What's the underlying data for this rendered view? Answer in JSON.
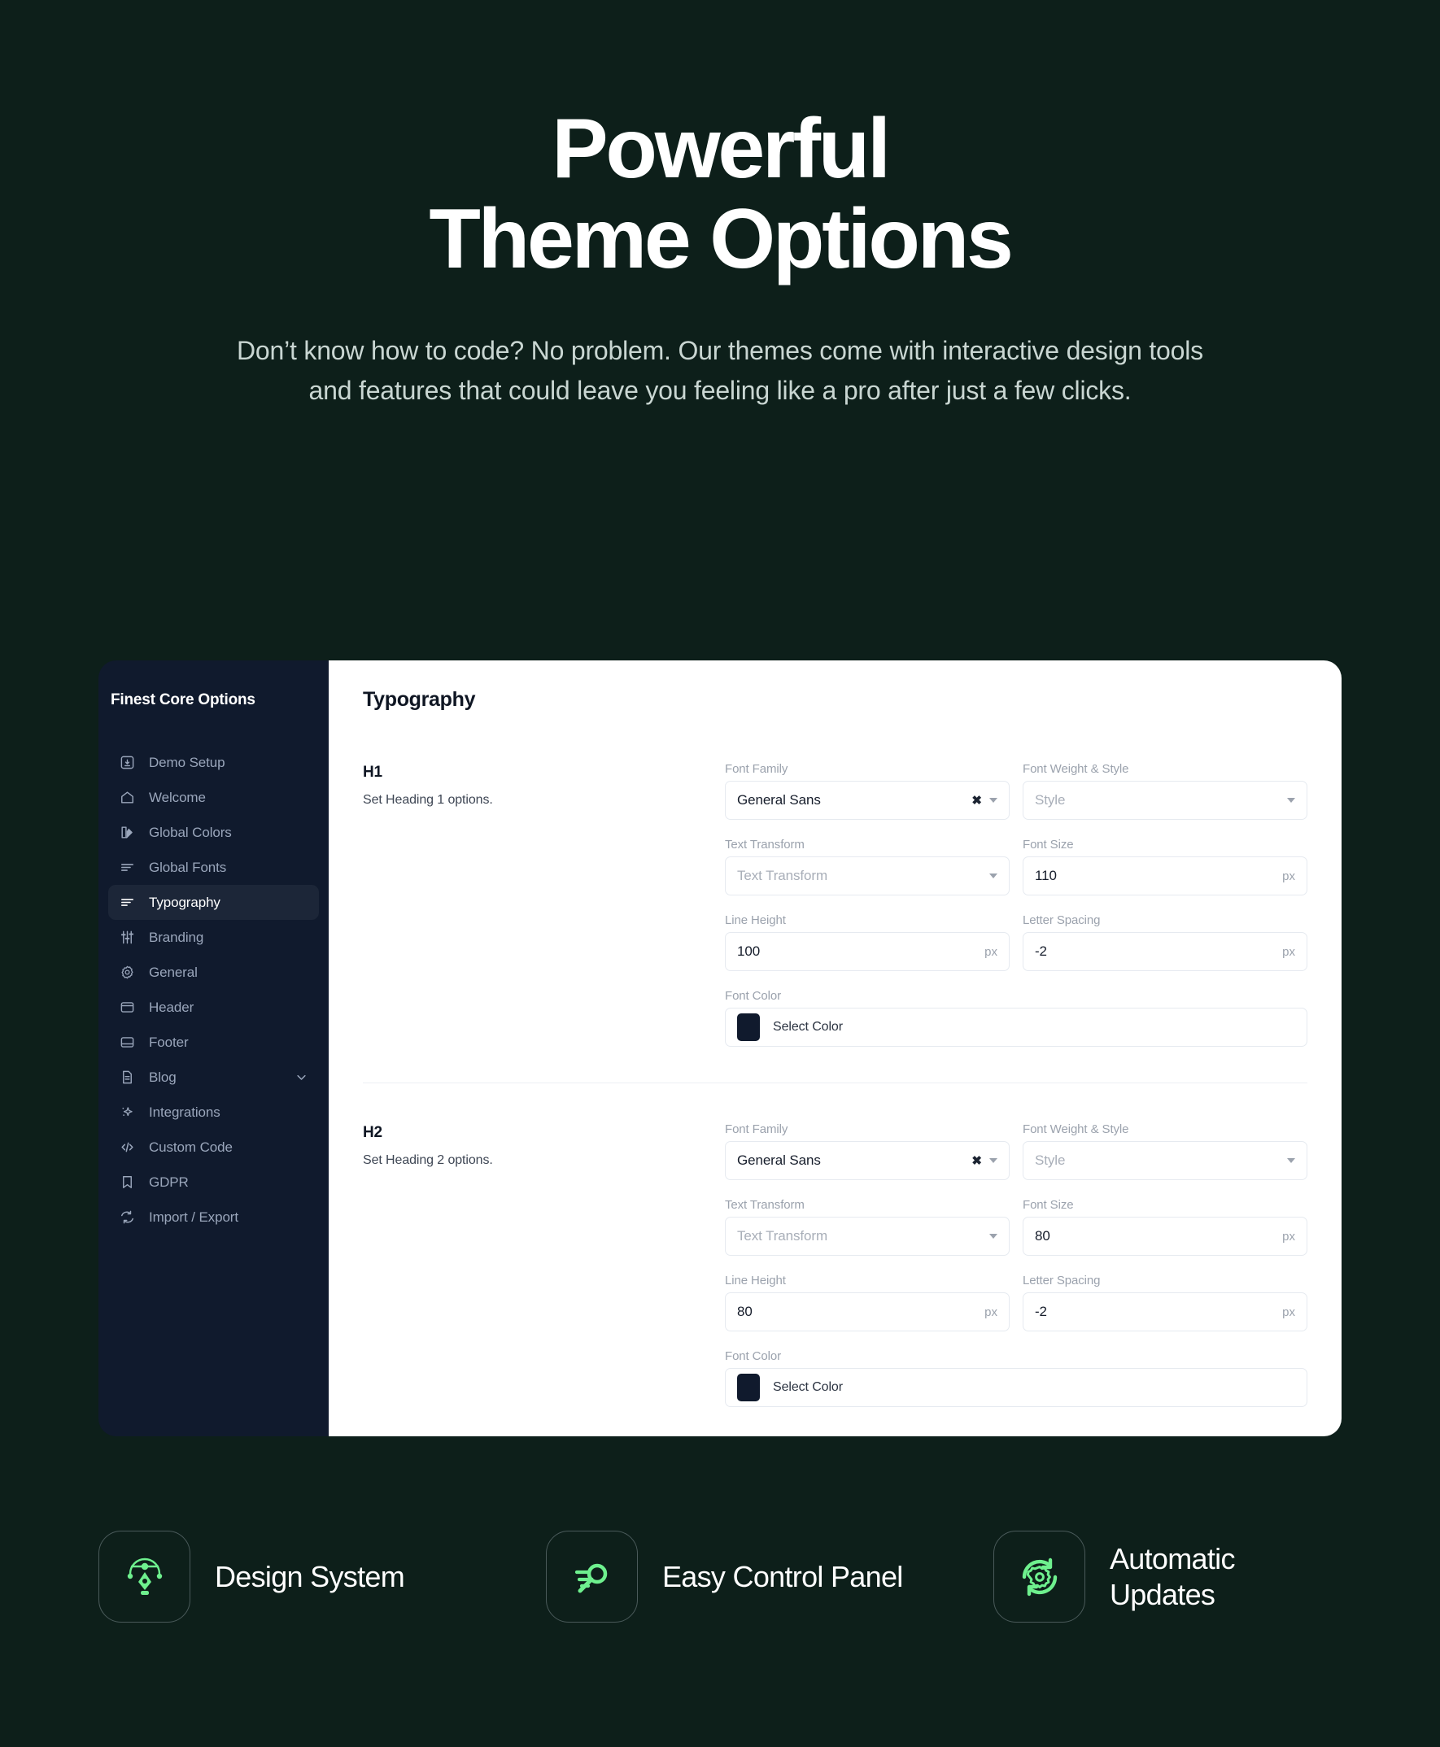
{
  "hero": {
    "title_line1": "Powerful",
    "title_line2": "Theme Options",
    "subtitle": "Don’t know how to code? No problem. Our themes come with interactive design tools and features that could leave you feeling like a pro after just a few clicks."
  },
  "colors": {
    "page_background": "#0d1f1a",
    "sidebar_background": "#101a2d",
    "panel_background": "#ffffff",
    "accent_green": "#6ef08e",
    "active_nav_background": "#1c2638",
    "swatch_color": "#101a2d"
  },
  "sidebar": {
    "title": "Finest Core Options",
    "items": [
      {
        "label": "Demo Setup",
        "icon": "download-box-icon",
        "active": false,
        "expandable": false
      },
      {
        "label": "Welcome",
        "icon": "home-icon",
        "active": false,
        "expandable": false
      },
      {
        "label": "Global Colors",
        "icon": "color-palette-icon",
        "active": false,
        "expandable": false
      },
      {
        "label": "Global Fonts",
        "icon": "text-lines-icon",
        "active": false,
        "expandable": false
      },
      {
        "label": "Typography",
        "icon": "text-lines-icon",
        "active": true,
        "expandable": false
      },
      {
        "label": "Branding",
        "icon": "sliders-icon",
        "active": false,
        "expandable": false
      },
      {
        "label": "General",
        "icon": "gear-icon",
        "active": false,
        "expandable": false
      },
      {
        "label": "Header",
        "icon": "header-layout-icon",
        "active": false,
        "expandable": false
      },
      {
        "label": "Footer",
        "icon": "footer-layout-icon",
        "active": false,
        "expandable": false
      },
      {
        "label": "Blog",
        "icon": "document-icon",
        "active": false,
        "expandable": true
      },
      {
        "label": "Integrations",
        "icon": "sparkles-icon",
        "active": false,
        "expandable": false
      },
      {
        "label": "Custom Code",
        "icon": "code-brackets-icon",
        "active": false,
        "expandable": false
      },
      {
        "label": "GDPR",
        "icon": "bookmark-icon",
        "active": false,
        "expandable": false
      },
      {
        "label": "Import / Export",
        "icon": "refresh-icon",
        "active": false,
        "expandable": false
      }
    ]
  },
  "main": {
    "title": "Typography",
    "sections": [
      {
        "heading": "H1",
        "description": "Set Heading 1 options.",
        "font_family": {
          "label": "Font Family",
          "value": "General Sans",
          "clear": "✖"
        },
        "font_weight_style": {
          "label": "Font Weight & Style",
          "placeholder": "Style"
        },
        "text_transform": {
          "label": "Text Transform",
          "placeholder": "Text Transform"
        },
        "font_size": {
          "label": "Font Size",
          "value": "110",
          "unit": "px"
        },
        "line_height": {
          "label": "Line Height",
          "value": "100",
          "unit": "px"
        },
        "letter_spacing": {
          "label": "Letter Spacing",
          "value": "-2",
          "unit": "px"
        },
        "font_color": {
          "label": "Font Color",
          "value": "Select Color",
          "swatch": "#101a2d"
        }
      },
      {
        "heading": "H2",
        "description": "Set Heading 2 options.",
        "font_family": {
          "label": "Font Family",
          "value": "General Sans",
          "clear": "✖"
        },
        "font_weight_style": {
          "label": "Font Weight & Style",
          "placeholder": "Style"
        },
        "text_transform": {
          "label": "Text Transform",
          "placeholder": "Text Transform"
        },
        "font_size": {
          "label": "Font Size",
          "value": "80",
          "unit": "px"
        },
        "line_height": {
          "label": "Line Height",
          "value": "80",
          "unit": "px"
        },
        "letter_spacing": {
          "label": "Letter Spacing",
          "value": "-2",
          "unit": "px"
        },
        "font_color": {
          "label": "Font Color",
          "value": "Select Color",
          "swatch": "#101a2d"
        }
      }
    ]
  },
  "features": [
    {
      "label": "Design System",
      "icon": "pen-tool-icon"
    },
    {
      "label": "Easy Control Panel",
      "icon": "comet-icon"
    },
    {
      "label": "Automatic Updates",
      "icon": "gear-refresh-icon"
    }
  ]
}
